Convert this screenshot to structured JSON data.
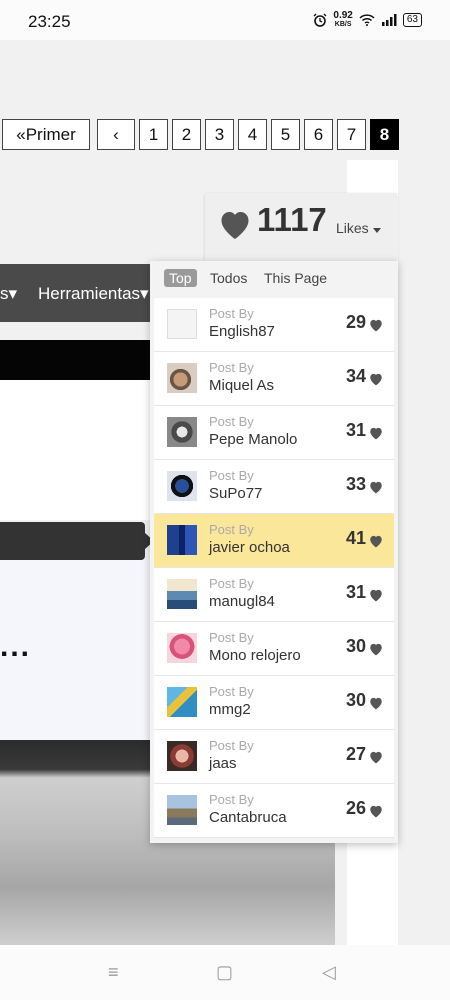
{
  "status_bar": {
    "time": "23:25",
    "alarm_icon": "alarm-icon",
    "net_speed_value": "0.92",
    "net_speed_unit": "KB/S",
    "wifi_icon": "wifi-icon",
    "signal_icon": "signal-icon",
    "battery": "63"
  },
  "pager": {
    "first_label": "«Primer",
    "prev_label": "‹",
    "pages": [
      "1",
      "2",
      "3",
      "4",
      "5",
      "6",
      "7",
      "8"
    ],
    "current_page": "8"
  },
  "nav": {
    "cut_item": "s▾",
    "item": "Herramientas▾"
  },
  "background": {
    "ellipsis": "..."
  },
  "likes": {
    "count": "1117",
    "label": "Likes",
    "tabs": [
      "Top",
      "Todos",
      "This Page"
    ],
    "active_tab": "Top",
    "post_by_label": "Post By",
    "heart_color": "#555555",
    "highlight_color": "#fbe79a",
    "rows": [
      {
        "user": "English87",
        "score": "29"
      },
      {
        "user": "Miquel As",
        "score": "34"
      },
      {
        "user": "Pepe Manolo",
        "score": "31"
      },
      {
        "user": "SuPo77",
        "score": "33"
      },
      {
        "user": "javier ochoa",
        "score": "41",
        "highlighted": true
      },
      {
        "user": "manugl84",
        "score": "31"
      },
      {
        "user": "Mono relojero",
        "score": "30"
      },
      {
        "user": "mmg2",
        "score": "30"
      },
      {
        "user": "jaas",
        "score": "27"
      },
      {
        "user": "Cantabruca",
        "score": "26"
      }
    ]
  },
  "bottom_nav": {
    "menu_icon": "≡",
    "home_icon": "▢",
    "back_icon": "◁"
  }
}
